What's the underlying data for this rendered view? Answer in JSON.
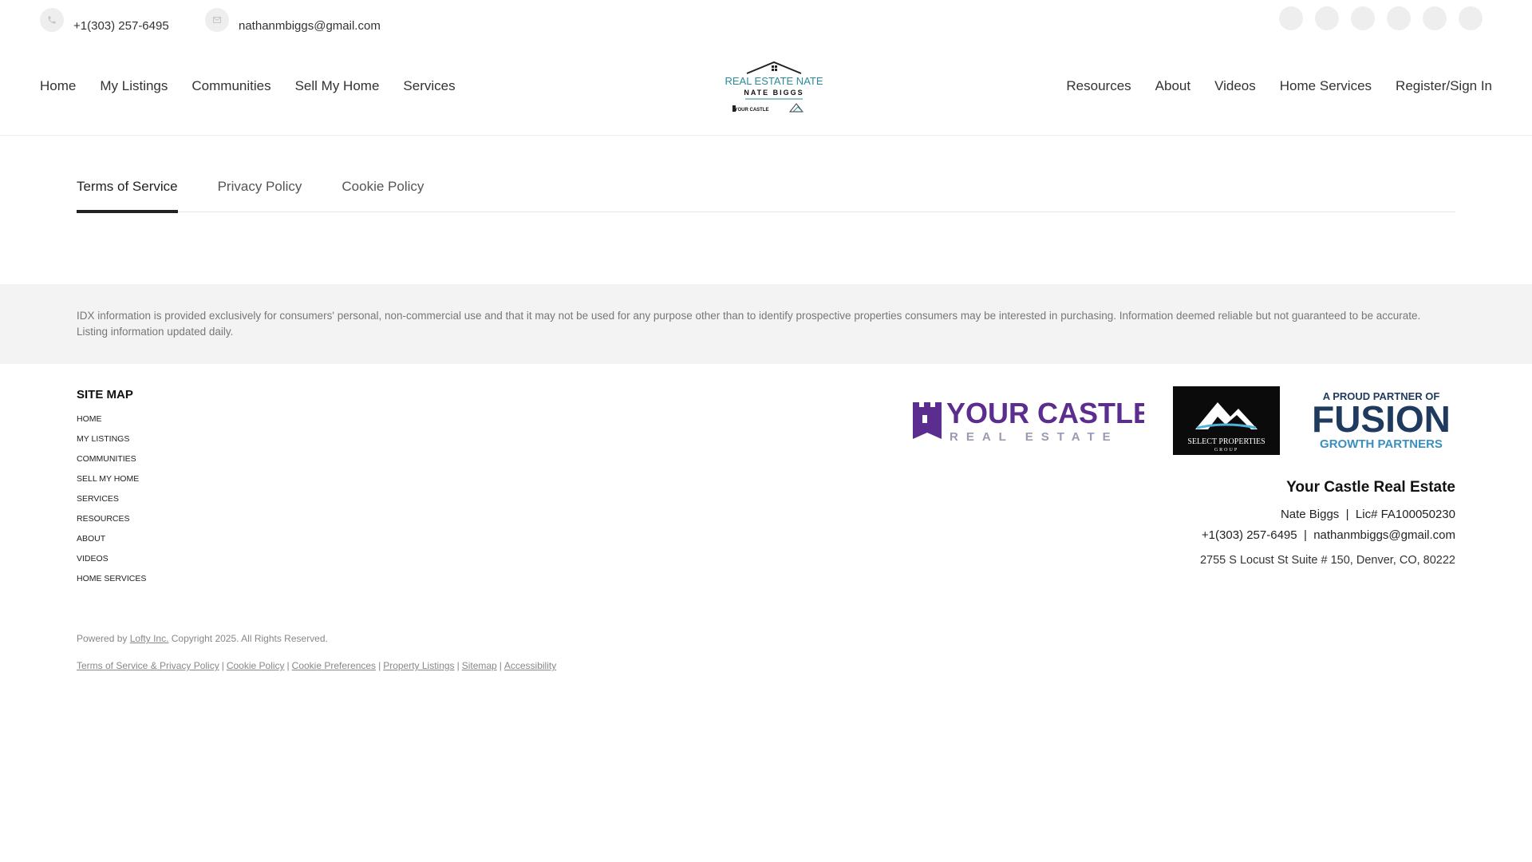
{
  "topbar": {
    "phone": "+1(303) 257-6495",
    "email": "nathanmbiggs@gmail.com",
    "socials": [
      "facebook-icon",
      "instagram-icon",
      "linkedin-icon",
      "youtube-icon",
      "tiktok-icon",
      "twitter-icon"
    ]
  },
  "nav": {
    "left": [
      "Home",
      "My Listings",
      "Communities",
      "Sell My Home",
      "Services"
    ],
    "right": [
      "Resources",
      "About",
      "Videos",
      "Home Services"
    ],
    "signin": "Register/Sign In"
  },
  "logo": {
    "line1": "REAL ESTATE NATE",
    "line2": "NATE BIGGS",
    "sub": "YOUR CASTLE"
  },
  "tabs": [
    "Terms of Service",
    "Privacy Policy",
    "Cookie Policy"
  ],
  "idx": {
    "text": "IDX information is provided exclusively for consumers' personal, non-commercial use and that it may not be used for any purpose other than to identify prospective properties consumers may be interested in purchasing. Information deemed reliable but not guaranteed to be accurate. Listing information updated daily."
  },
  "sitemap": {
    "title": "SITE MAP",
    "items": [
      "HOME",
      "MY LISTINGS",
      "COMMUNITIES",
      "SELL MY HOME",
      "SERVICES",
      "RESOURCES",
      "ABOUT",
      "VIDEOS",
      "HOME SERVICES"
    ]
  },
  "brands": {
    "castle_top": "YOUR CASTLE",
    "castle_bottom": "REAL ESTATE",
    "select_main": "SELECT PROPERTIES",
    "select_sub": "GROUP",
    "fusion_top": "A PROUD PARTNER OF",
    "fusion_main": "FUSION",
    "fusion_bottom": "GROWTH PARTNERS"
  },
  "company": {
    "name": "Your Castle Real Estate",
    "agent": "Nate Biggs",
    "license": "Lic# FA100050230",
    "phone": "+1(303) 257-6495",
    "email": "nathanmbiggs@gmail.com",
    "address": "2755 S Locust St Suite # 150, Denver, CO, 80222"
  },
  "footer": {
    "powered_prefix": "Powered by",
    "powered_link": "Lofty Inc.",
    "copyright": "Copyright 2025. All Rights Reserved.",
    "legal_links": [
      "Terms of Service & Privacy Policy",
      "Cookie Policy",
      "Cookie Preferences",
      "Property Listings",
      "Sitemap",
      "Accessibility"
    ]
  },
  "colors": {
    "castle_purple": "#5b2d8e",
    "castle_gray": "#9a9ab0",
    "fusion_navy": "#1f3a5f",
    "fusion_teal": "#3a8fc0",
    "logo_teal": "#2b8a9a"
  }
}
